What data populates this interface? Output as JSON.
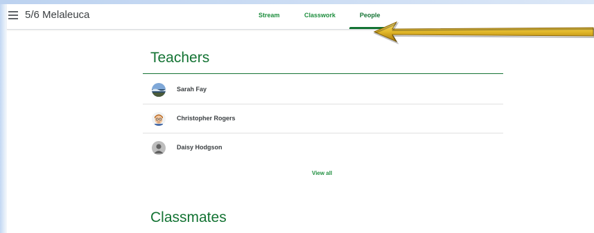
{
  "header": {
    "class_name": "5/6 Melaleuca",
    "tabs": [
      {
        "label": "Stream"
      },
      {
        "label": "Classwork"
      },
      {
        "label": "People",
        "active": true
      }
    ]
  },
  "teachers": {
    "title": "Teachers",
    "people": [
      {
        "name": "Sarah Fay",
        "avatar": "landscape-photo"
      },
      {
        "name": "Christopher Rogers",
        "avatar": "cartoon-face"
      },
      {
        "name": "Daisy Hodgson",
        "avatar": "default-person"
      }
    ],
    "view_all_label": "View all"
  },
  "classmates": {
    "title": "Classmates"
  },
  "colors": {
    "accent": "#137333",
    "tab_text": "#1e8e3e",
    "arrow": "#d4a017"
  }
}
